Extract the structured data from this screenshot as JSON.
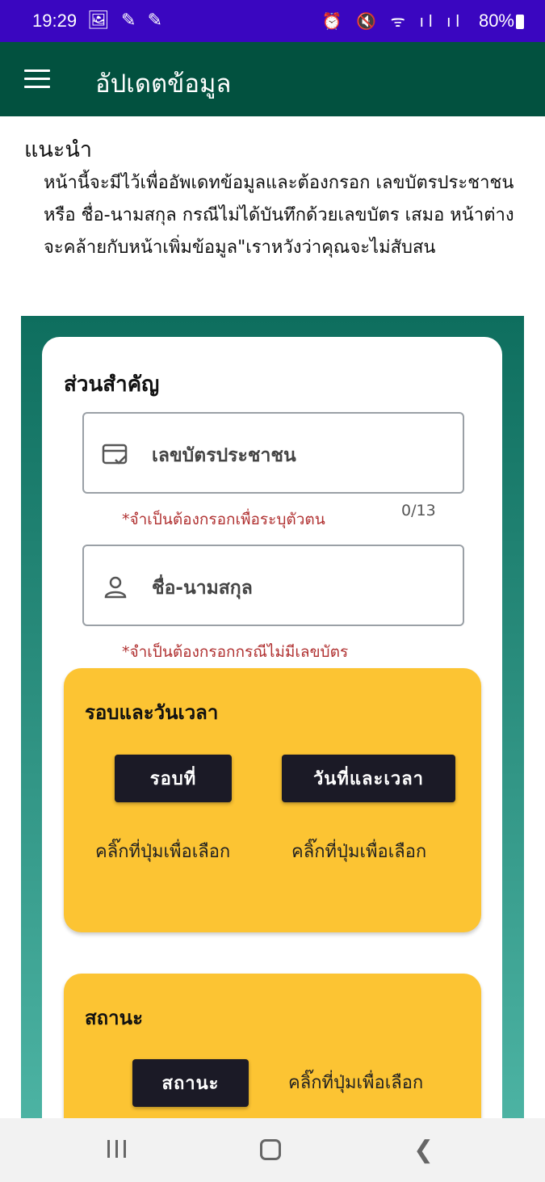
{
  "status_bar": {
    "time": "19:29",
    "left_icons": "🖼 ✎ ✎",
    "right_icons": "⏰ 🔇 ᯤ ıl ıl",
    "battery": "80%"
  },
  "app_bar": {
    "title": "อัปเดตข้อมูล"
  },
  "intro": {
    "title": "แนะนำ",
    "text": "หน้านี้จะมีไว้เพื่ออัพเดทข้อมูลและต้องกรอก เลขบัตรประชาชน หรือ ชื่อ-นามสกุล กรณีไม่ได้บันทึกด้วยเลขบัตร เสมอ หน้าต่างจะคล้ายกับหน้าเพิ่มข้อมูล\"เราหวังว่าคุณจะไม่สับสน"
  },
  "important_section": {
    "title": "ส่วนสำคัญ",
    "id_field": {
      "label": "เลขบัตรประชาชน",
      "hint": "*จำเป็นต้องกรอกเพื่อระบุตัวตน",
      "counter": "0/13"
    },
    "name_field": {
      "label": "ชื่อ-นามสกุล",
      "hint": "*จำเป็นต้องกรอกกรณีไม่มีเลขบัตร"
    }
  },
  "round_section": {
    "title": "รอบและวันเวลา",
    "round_button": "รอบที่",
    "datetime_button": "วันที่และเวลา",
    "round_hint": "คลิ๊กที่ปุ่มเพื่อเลือก",
    "datetime_hint": "คลิ๊กที่ปุ่มเพื่อเลือก"
  },
  "status_section": {
    "title": "สถานะ",
    "status_button": "สถานะ",
    "status_hint": "คลิ๊กที่ปุ่มเพื่อเลือก"
  },
  "colors": {
    "status_bar": "#3a06c0",
    "app_bar": "#02513f",
    "panel_top": "#0e6e5e",
    "panel_bottom": "#4cb3a3",
    "section_card": "#fcc433",
    "button": "#1b1a26",
    "hint": "#b03030"
  }
}
